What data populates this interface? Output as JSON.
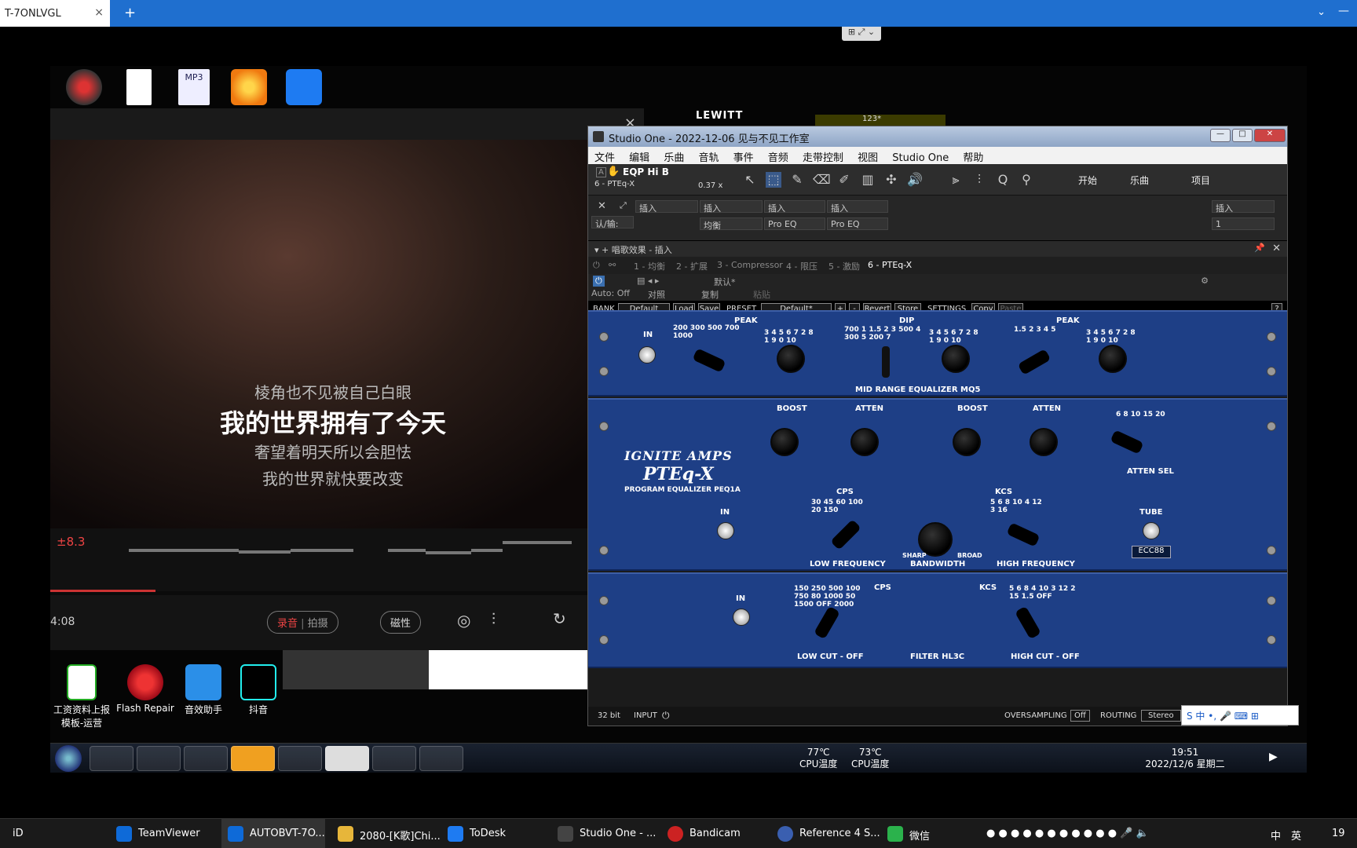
{
  "browser": {
    "tab_title": "T-7ONLVGL",
    "tab_close": "×",
    "new_tab": "+",
    "collapse": "⌄",
    "minimize": "—",
    "remote_strip": "⊞ ⤢ ⌄"
  },
  "desktop": {
    "top_icons": [
      "",
      "",
      "MP3",
      ""
    ],
    "bottom_icons": [
      {
        "label": "工资资料上报模板-运营"
      },
      {
        "label": "Flash Repair"
      },
      {
        "label": "音效助手"
      },
      {
        "label": "抖音"
      }
    ]
  },
  "karaoke": {
    "close": "×",
    "lyrics": [
      "棱角也不见被自己白眼",
      "我的世界拥有了今天",
      "奢望着明天所以会胆怯",
      "我的世界就快要改变"
    ],
    "score": "±8.3",
    "right_digit": "8",
    "time": "4:08",
    "record": "录音",
    "beat": "拍摄",
    "magnetic": "磁性"
  },
  "lewitt": {
    "brand": "LEWITT",
    "value": "123*"
  },
  "studio_one": {
    "title": "Studio One - 2022-12-06 见与不见工作室",
    "menu": [
      "文件",
      "编辑",
      "乐曲",
      "音轨",
      "事件",
      "音频",
      "走带控制",
      "视图",
      "Studio One",
      "帮助"
    ],
    "track_name": "EQP Hi B",
    "track_sub": "6 - PTEq-X",
    "zoom": "0.37 x",
    "right_buttons": [
      "开始",
      "乐曲",
      "项目"
    ],
    "inserts": [
      "插入",
      "插入",
      "插入",
      "插入",
      "插入"
    ],
    "insert_values": [
      "认/输:",
      "均衡",
      "Pro EQ",
      "Pro EQ",
      "1"
    ],
    "fx_title": "唱歌效果 - 插入",
    "fx_tabs": [
      "1 - 均衡",
      "2 - 扩展",
      "3 - Compressor",
      "4 - 限压",
      "5 - 激励",
      "6 - PTEq-X"
    ],
    "preset_default": "默认*",
    "auto": "Auto: Off",
    "compare": "对照",
    "copy": "复制",
    "paste": "粘贴",
    "bank": {
      "bank_label": "BANK",
      "bank_value": "Default",
      "load": "Load",
      "save": "Save",
      "preset_label": "PRESET",
      "preset_value": "Default*",
      "plus": "+",
      "minus": "-",
      "revert": "Revert",
      "store": "Store",
      "settings_label": "SETTINGS",
      "copy": "Copy",
      "paste": "Paste",
      "help": "?"
    }
  },
  "plugin": {
    "mq5": {
      "in": "IN",
      "peak": "PEAK",
      "dip": "DIP",
      "peak2": "PEAK",
      "name": "MID RANGE EQUALIZER MQ5",
      "scale_freq1": "200 300 500 700 1000",
      "scale_dip": "700 1 1.5 2 3 500 4 300 5 200 7",
      "scale_knob": "3 4 5 6 7 2 8 1 9 0 10",
      "scale_freq3": "1.5 2 3 4 5"
    },
    "peq1a": {
      "brand": "IGNITE AMPS",
      "product": "PTEq-X",
      "subtitle": "PROGRAM EQUALIZER PEQ1A",
      "boost": "BOOST",
      "atten": "ATTEN",
      "atten_sel": "ATTEN SEL",
      "atten_sel_scale": "6 8 10 15 20",
      "in": "IN",
      "cps": "CPS",
      "cps_scale": "30 45 60 100 20 150",
      "kcs": "KCS",
      "kcs_scale": "5 6 8 10 4 12 3 16",
      "tube": "TUBE",
      "tube_value": "ECC88",
      "low_frequency": "LOW FREQUENCY",
      "bandwidth": "BANDWIDTH",
      "sharp": "SHARP",
      "broad": "BROAD",
      "high_frequency": "HIGH FREQUENCY"
    },
    "hl3c": {
      "in": "IN",
      "cps": "CPS",
      "cps_scale": "150 250 500 100 750 80 1000 50 1500 OFF 2000",
      "kcs": "KCS",
      "kcs_scale": "5 6 8 4 10 3 12 2 15 1.5 OFF",
      "low_cut": "LOW CUT - OFF",
      "name": "FILTER HL3C",
      "high_cut": "HIGH CUT - OFF"
    },
    "status": {
      "bits": "32 bit",
      "input": "INPUT",
      "oversampling": "OVERSAMPLING",
      "os_value": "Off",
      "routing": "ROUTING",
      "routing_value": "Stereo"
    }
  },
  "ime": {
    "text": "S 中 •, 🎤 ⌨ ⊞"
  },
  "remote_taskbar": {
    "cpu1_temp": "77℃",
    "cpu1_label": "CPU温度",
    "cpu2_temp": "73℃",
    "cpu2_label": "CPU温度",
    "time": "19:51",
    "date": "2022/12/6 星期二"
  },
  "local_taskbar": {
    "start": "iD",
    "items": [
      "TeamViewer",
      "AUTOBVT-7O...",
      "2080-[K歌]Chi...",
      "ToDesk",
      "Studio One - ...",
      "Bandicam",
      "Reference 4 S...",
      "微信"
    ],
    "tray_lang": "中",
    "tray_lang2": "英",
    "tray_time": "19"
  }
}
